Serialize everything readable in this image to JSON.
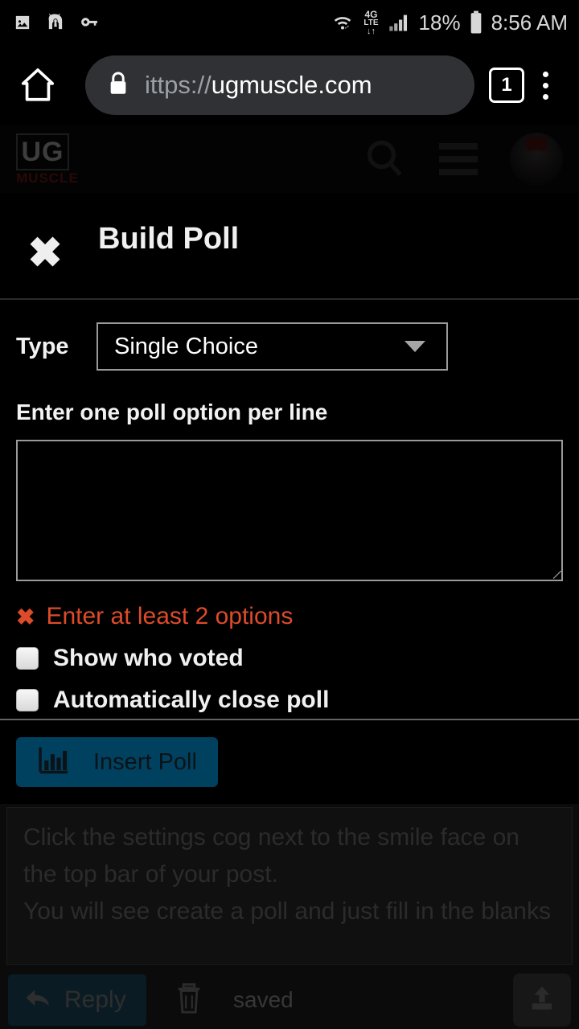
{
  "statusbar": {
    "left_icons": [
      "image-icon",
      "vpn-android-icon",
      "key-icon"
    ],
    "wifi_icon": "wifi-icon",
    "network_line1": "4G",
    "network_line2": "LTE",
    "signal_icon": "signal-bars-icon",
    "battery_percent": "18%",
    "battery_icon": "battery-icon",
    "time": "8:56 AM"
  },
  "browser": {
    "home_icon": "home-icon",
    "lock_icon": "lock-icon",
    "url_scheme": "ittps://",
    "url_host": "ugmuscle.com",
    "tab_count": "1",
    "menu_icon": "kebab-menu-icon"
  },
  "site_header": {
    "logo_main": "UG",
    "logo_sub": "MUSCLE",
    "search_icon": "search-icon",
    "menu_icon": "hamburger-menu-icon",
    "avatar": "user-avatar"
  },
  "modal": {
    "close_label": "✖",
    "title": "Build Poll",
    "type_label": "Type",
    "type_value": "Single Choice",
    "type_options": [
      "Single Choice"
    ],
    "caret_icon": "chevron-down-icon",
    "options_label": "Enter one poll option per line",
    "options_value": "",
    "options_placeholder": "",
    "error_icon": "✖",
    "error_text": "Enter at least 2 options",
    "error_color": "#dd4b2a",
    "checkbox_show_voters": "Show who voted",
    "checkbox_show_voters_checked": false,
    "checkbox_auto_close": "Automatically close poll",
    "checkbox_auto_close_checked": false,
    "insert_button_label": "Insert Poll",
    "insert_button_icon": "bar-chart-icon",
    "insert_button_color": "#00415f"
  },
  "page": {
    "editor_text": "Click the settings cog next to the smile face on the top bar of your post.\nYou will see create a poll and just fill in the blanks",
    "reply_label": "Reply",
    "reply_icon": "reply-arrow-icon",
    "delete_icon": "trash-icon",
    "saved_text": "saved",
    "upload_icon": "upload-icon"
  }
}
